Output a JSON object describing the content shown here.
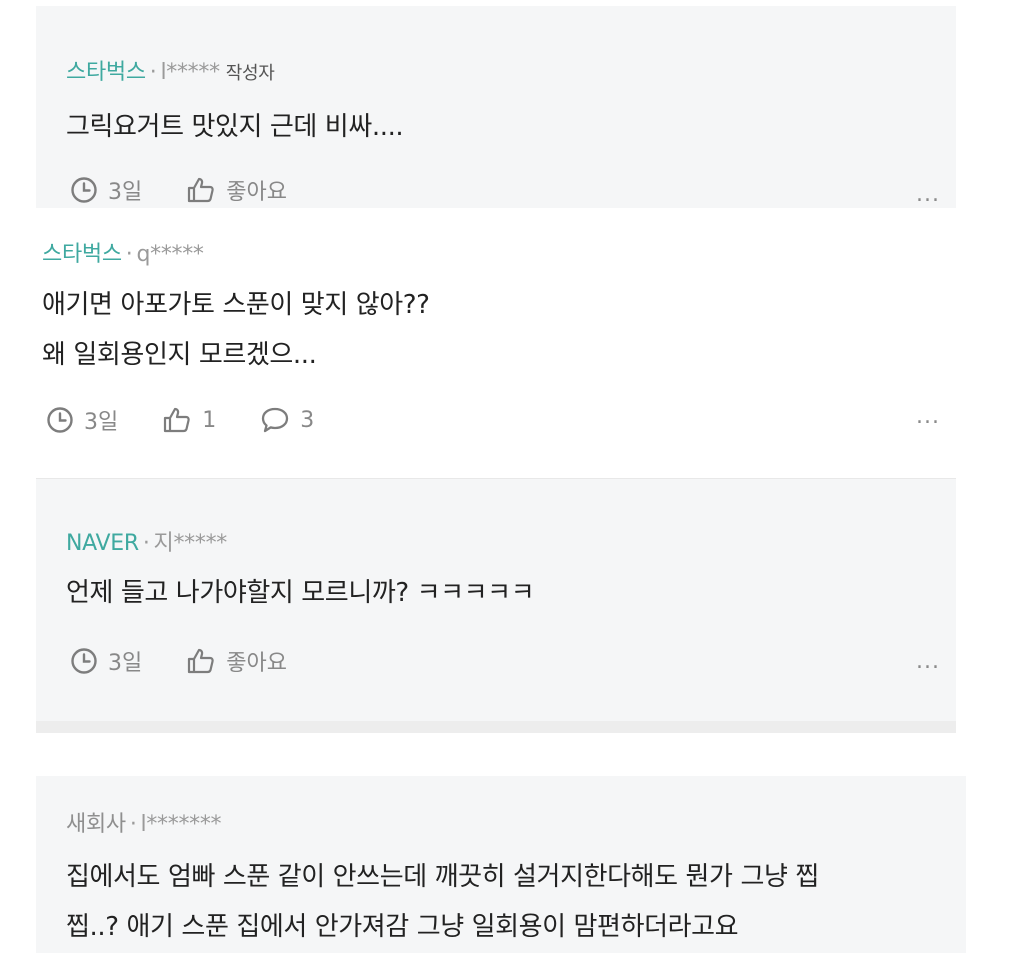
{
  "comments": [
    {
      "source": "스타벅스",
      "user": "l*****",
      "badge": "작성자",
      "lines": [
        "그릭요거트 맛있지 근데 비싸...."
      ],
      "time": "3일",
      "like": "좋아요",
      "more": "..."
    },
    {
      "source": "스타벅스",
      "user": "q*****",
      "lines": [
        "애기면 아포가토 스푼이 맞지 않아??",
        "왜 일회용인지 모르겠으..."
      ],
      "time": "3일",
      "like": "1",
      "replies": "3",
      "more": "..."
    },
    {
      "source": "NAVER",
      "user": "지*****",
      "lines": [
        "언제 들고 나가야할지 모르니까? ㅋㅋㅋㅋㅋ"
      ],
      "time": "3일",
      "like": "좋아요",
      "more": "..."
    },
    {
      "source": "새회사",
      "user": "l*******",
      "lines": [
        "집에서도 엄빠 스푼 같이 안쓰는데 깨끗히 설거지한다해도 뭔가 그냥 찝",
        "찝..? 애기 스푼 집에서 안가져감 그냥 일회용이 맘편하더라고요"
      ]
    }
  ],
  "separator": "·",
  "colors": {
    "source_accent": "#3fa9a0",
    "card_gray": "#f5f6f7",
    "text": "#222222",
    "muted": "#888888"
  },
  "icons": [
    "clock-icon",
    "thumbs-up-icon",
    "speech-bubble-icon",
    "more-dots-icon"
  ]
}
